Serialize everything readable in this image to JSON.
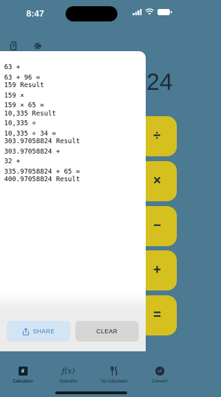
{
  "status_bar": {
    "time": "8:47"
  },
  "background": {
    "display_value": "24",
    "operators": [
      {
        "name": "divide-button",
        "label": "÷"
      },
      {
        "name": "multiply-button",
        "label": "×"
      },
      {
        "name": "subtract-button",
        "label": "−"
      },
      {
        "name": "add-button",
        "label": "+"
      },
      {
        "name": "equals-button",
        "label": "="
      }
    ]
  },
  "history": [
    "63 +",
    "63 + 96 =\n159 Result",
    "159 ×",
    "159 × 65 =\n10,335 Result",
    "10,335 ÷",
    "10,335 ÷ 34 =\n303.97058824 Result",
    "303.97058824 +",
    "32 +",
    "335.97058824 + 65 =\n400.97058824 Result"
  ],
  "actions": {
    "share_label": "SHARE",
    "clear_label": "CLEAR"
  },
  "tabs": [
    {
      "label": "Calculator",
      "icon": "calculator-icon"
    },
    {
      "label": "Scientific",
      "icon": "function-icon"
    },
    {
      "label": "Tip Calculator",
      "icon": "utensils-icon"
    },
    {
      "label": "Convert",
      "icon": "convert-icon"
    }
  ],
  "colors": {
    "background": "#4b7a92",
    "operator": "#d6c020",
    "share_text": "#3f7fc1"
  }
}
